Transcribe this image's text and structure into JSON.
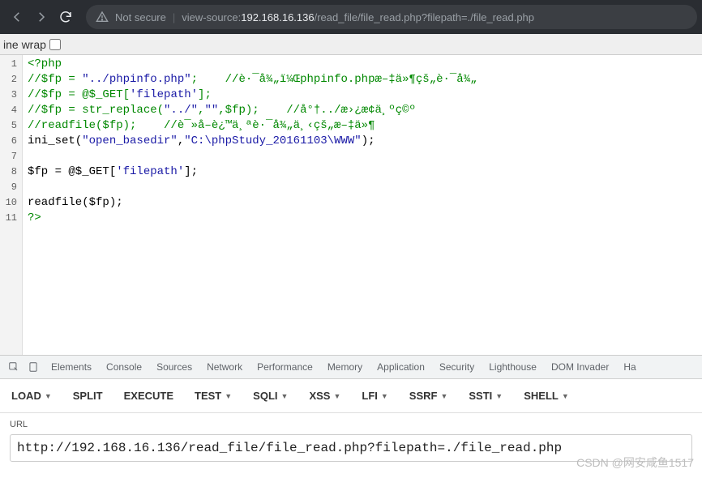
{
  "address_bar": {
    "not_secure_label": "Not secure",
    "url_prefix": "view-source:",
    "url_host": "192.168.16.136",
    "url_path": "/read_file/file_read.php?filepath=./file_read.php"
  },
  "linewrap": {
    "label": "ine wrap",
    "checked": false
  },
  "source": {
    "lines": [
      [
        {
          "t": "<?php",
          "c": "c-green"
        }
      ],
      [
        {
          "t": "//$fp = ",
          "c": "c-green"
        },
        {
          "t": "\"../phpinfo.php\"",
          "c": "c-str"
        },
        {
          "t": ";    //è·¯å¾„ï¼Œphpinfo.phpæ–‡ä»¶çš„è·¯å¾„",
          "c": "c-green"
        }
      ],
      [
        {
          "t": "//$fp = @$_GET[",
          "c": "c-green"
        },
        {
          "t": "'filepath'",
          "c": "c-str"
        },
        {
          "t": "];",
          "c": "c-green"
        }
      ],
      [
        {
          "t": "//$fp = str_replace(",
          "c": "c-green"
        },
        {
          "t": "\"../\"",
          "c": "c-str"
        },
        {
          "t": ",",
          "c": "c-green"
        },
        {
          "t": "\"\"",
          "c": "c-str"
        },
        {
          "t": ",$fp);    //å°†../æ›¿æ¢ä¸ºç©º",
          "c": "c-green"
        }
      ],
      [
        {
          "t": "//readfile($fp);    //è¯»å–è¿™ä¸ªè·¯å¾„ä¸‹çš„æ–‡ä»¶",
          "c": "c-green"
        }
      ],
      [
        {
          "t": "ini_set(",
          "c": "c-plain"
        },
        {
          "t": "\"open_basedir\"",
          "c": "c-str"
        },
        {
          "t": ",",
          "c": "c-plain"
        },
        {
          "t": "\"C:\\phpStudy_20161103\\WWW\"",
          "c": "c-str"
        },
        {
          "t": ");",
          "c": "c-plain"
        }
      ],
      [],
      [
        {
          "t": "$fp = @$_GET[",
          "c": "c-plain"
        },
        {
          "t": "'filepath'",
          "c": "c-str"
        },
        {
          "t": "];",
          "c": "c-plain"
        }
      ],
      [],
      [
        {
          "t": "readfile($fp);",
          "c": "c-plain"
        }
      ],
      [
        {
          "t": "?>",
          "c": "c-green"
        }
      ]
    ]
  },
  "devtools_tabs": [
    "Elements",
    "Console",
    "Sources",
    "Network",
    "Performance",
    "Memory",
    "Application",
    "Security",
    "Lighthouse",
    "DOM Invader",
    "Ha"
  ],
  "hack_tabs": [
    {
      "label": "LOAD",
      "dd": true,
      "strong": true
    },
    {
      "label": "SPLIT",
      "dd": false,
      "strong": true
    },
    {
      "label": "EXECUTE",
      "dd": false,
      "strong": true
    },
    {
      "label": "TEST",
      "dd": true,
      "strong": true
    },
    {
      "label": "SQLI",
      "dd": true,
      "strong": true
    },
    {
      "label": "XSS",
      "dd": true,
      "strong": true
    },
    {
      "label": "LFI",
      "dd": true,
      "strong": true
    },
    {
      "label": "SSRF",
      "dd": true,
      "strong": true
    },
    {
      "label": "SSTI",
      "dd": true,
      "strong": true
    },
    {
      "label": "SHELL",
      "dd": true,
      "strong": true
    }
  ],
  "url_field": {
    "label": "URL",
    "value": "http://192.168.16.136/read_file/file_read.php?filepath=./file_read.php"
  },
  "watermark": "CSDN @网安咸鱼1517",
  "caret_glyph": "▼"
}
